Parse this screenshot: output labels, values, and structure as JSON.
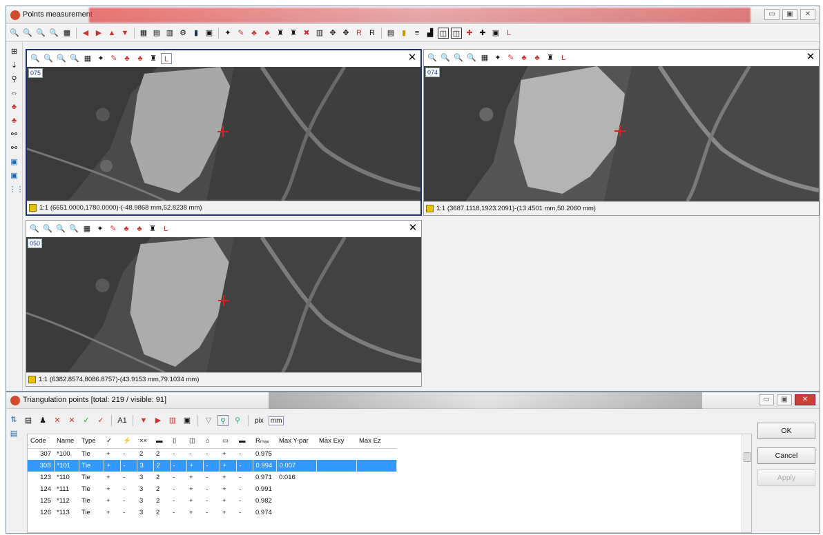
{
  "main_window": {
    "title": "Points measurement",
    "toolbar_letter": "L"
  },
  "panes": [
    {
      "id": "075",
      "status": "1:1 (6651.0000,1780.0000)-(-48.9868 mm,52.8238 mm)",
      "close": "✕"
    },
    {
      "id": "074",
      "status": "1:1 (3687.1118,1923.2091)-(13.4501 mm,50.2060 mm)",
      "close": "✕"
    },
    {
      "id": "050",
      "status": "1:1 (6382.8574,8086.8757)-(43.9153 mm,79.1034 mm)",
      "close": "✕"
    }
  ],
  "points_window": {
    "title": "Triangulation points [total: 219 / visible: 91]",
    "unit_pix": "pix",
    "unit_mm": "mm",
    "columns": [
      "Code",
      "Name",
      "Type",
      "✓",
      "⚡",
      "××",
      "▬",
      "▯",
      "◫",
      "⌂",
      "▭",
      "▬",
      "Rₘₐₓ",
      "Max Y-par",
      "Max Exy",
      "Max Ez"
    ],
    "rows": [
      [
        "307",
        "*100",
        "Tie",
        "+",
        "-",
        "2",
        "2",
        "-",
        "-",
        "-",
        "+",
        "-",
        "0.975",
        "",
        "",
        ""
      ],
      [
        "308",
        "*101",
        "Tie",
        "+",
        "-",
        "3",
        "2",
        "-",
        "+",
        "-",
        "+",
        "-",
        "0.994",
        "0.007",
        "",
        ""
      ],
      [
        "123",
        "*110",
        "Tie",
        "+",
        "-",
        "3",
        "2",
        "-",
        "+",
        "-",
        "+",
        "-",
        "0.971",
        "0.016",
        "",
        ""
      ],
      [
        "124",
        "*111",
        "Tie",
        "+",
        "-",
        "3",
        "2",
        "-",
        "+",
        "-",
        "+",
        "-",
        "0.991",
        "",
        "",
        ""
      ],
      [
        "125",
        "*112",
        "Tie",
        "+",
        "-",
        "3",
        "2",
        "-",
        "+",
        "-",
        "+",
        "-",
        "0.982",
        "",
        "",
        ""
      ],
      [
        "126",
        "*113",
        "Tie",
        "+",
        "-",
        "3",
        "2",
        "-",
        "+",
        "-",
        "+",
        "-",
        "0.974",
        "",
        "",
        ""
      ]
    ],
    "selected_row": 1,
    "buttons": {
      "ok": "OK",
      "cancel": "Cancel",
      "apply": "Apply"
    }
  },
  "colors": {
    "selection": "#3399ff",
    "active_pane_border": "#1b2f7a",
    "cross": "#e02020"
  }
}
